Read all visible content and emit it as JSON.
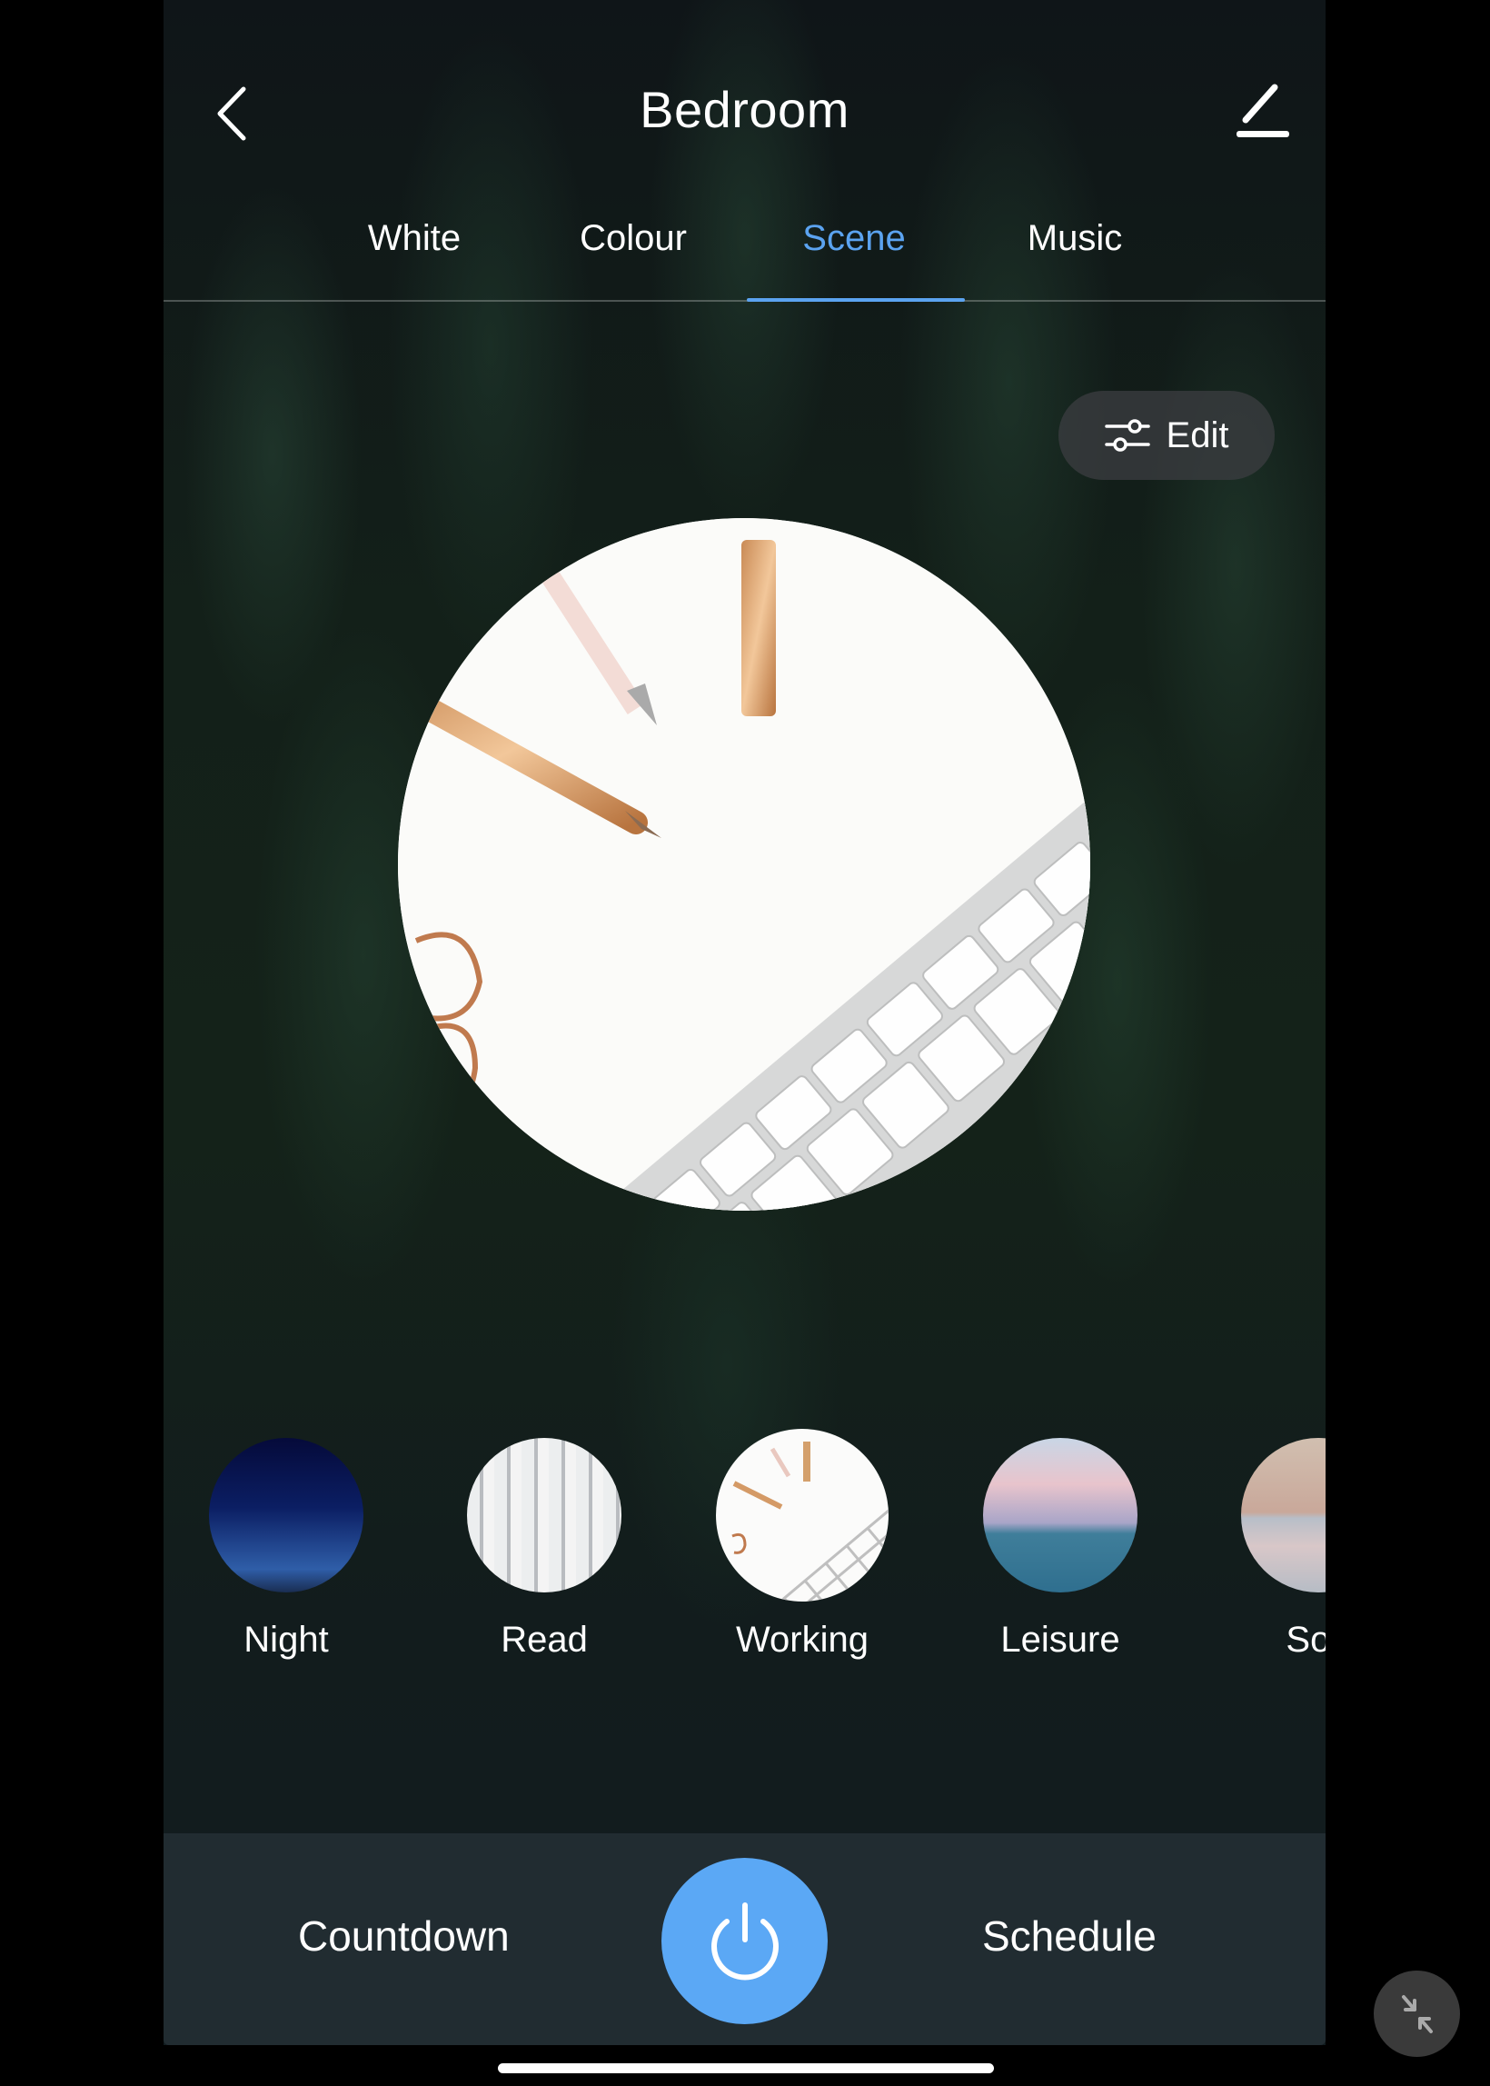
{
  "header": {
    "title": "Bedroom",
    "back_icon": "chevron-left-icon",
    "edit_icon": "pencil-icon"
  },
  "tabs": [
    {
      "label": "White",
      "active": false
    },
    {
      "label": "Colour",
      "active": false
    },
    {
      "label": "Scene",
      "active": true
    },
    {
      "label": "Music",
      "active": false
    }
  ],
  "edit_button": {
    "label": "Edit",
    "icon": "sliders-icon"
  },
  "current_scene": {
    "name": "Working",
    "image": "desk-pens-keyboard"
  },
  "scenes": [
    {
      "name": "Night",
      "image": "night-sky",
      "selected": false
    },
    {
      "name": "Read",
      "image": "library",
      "selected": false
    },
    {
      "name": "Working",
      "image": "desk-pens-keyboard",
      "selected": true
    },
    {
      "name": "Leisure",
      "image": "sunset-sea",
      "selected": false
    },
    {
      "name": "Soft",
      "image": "dunes",
      "selected": false
    }
  ],
  "bottom_bar": {
    "countdown_label": "Countdown",
    "schedule_label": "Schedule",
    "power_icon": "power-icon"
  },
  "colors": {
    "accent": "#5ba3f0",
    "power_button": "#5ba8f5",
    "bottom_bar": "#212c31",
    "edit_pill": "#3c3e41"
  }
}
